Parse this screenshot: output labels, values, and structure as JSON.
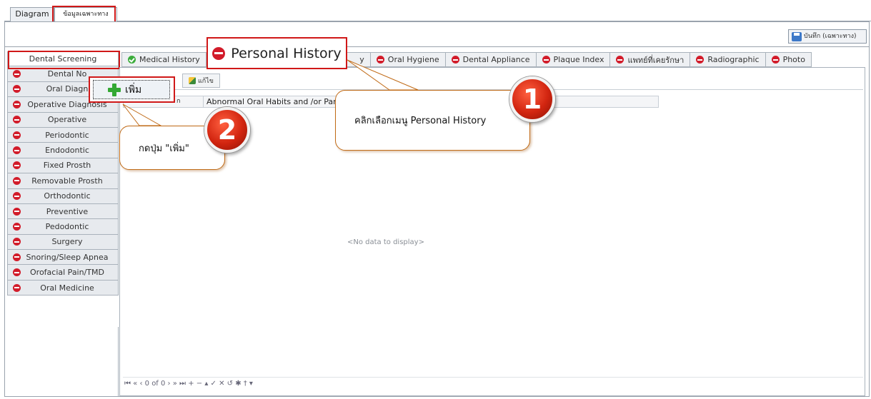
{
  "top_tabs": [
    "Diagram",
    "ข้อมูลเฉพาะทาง"
  ],
  "toolbar": {
    "save_label": "บันทึก (เฉพาะทาง)"
  },
  "left_menu": [
    {
      "label": "Dental Screening",
      "icon": "none",
      "active": true
    },
    {
      "label": "Dental No",
      "icon": "minus-circle-icon"
    },
    {
      "label": "Oral Diagn",
      "icon": "minus-circle-icon"
    },
    {
      "label": "Operative Diagnosis",
      "icon": "minus-circle-icon"
    },
    {
      "label": "Operative",
      "icon": "minus-circle-icon"
    },
    {
      "label": "Periodontic",
      "icon": "minus-circle-icon"
    },
    {
      "label": "Endodontic",
      "icon": "minus-circle-icon"
    },
    {
      "label": "Fixed Prosth",
      "icon": "minus-circle-icon"
    },
    {
      "label": "Removable Prosth",
      "icon": "minus-circle-icon"
    },
    {
      "label": "Orthodontic",
      "icon": "minus-circle-icon"
    },
    {
      "label": "Preventive",
      "icon": "minus-circle-icon"
    },
    {
      "label": "Pedodontic",
      "icon": "minus-circle-icon"
    },
    {
      "label": "Surgery",
      "icon": "minus-circle-icon"
    },
    {
      "label": "Snoring/Sleep Apnea",
      "icon": "minus-circle-icon"
    },
    {
      "label": "Orofacial Pain/TMD",
      "icon": "minus-circle-icon"
    },
    {
      "label": "Oral Medicine",
      "icon": "minus-circle-icon"
    }
  ],
  "right_tabs": [
    {
      "label": "Medical History",
      "icon": "check-circle-icon"
    },
    {
      "label": "y",
      "icon": "none"
    },
    {
      "label": "Oral Hygiene",
      "icon": "minus-circle-icon"
    },
    {
      "label": "Dental Appliance",
      "icon": "minus-circle-icon"
    },
    {
      "label": "Plaque Index",
      "icon": "minus-circle-icon"
    },
    {
      "label": "แพทย์ที่เคยรักษา",
      "icon": "minus-circle-icon"
    },
    {
      "label": "Radiographic",
      "icon": "minus-circle-icon"
    },
    {
      "label": "Photo",
      "icon": "minus-circle-icon"
    }
  ],
  "personal_history_tab": "Personal History",
  "add_button": "เพิ่ม",
  "edit_button": "แก้ไข",
  "grid": {
    "col1": "ก",
    "col2": "Abnormal Oral Habits and /or Para"
  },
  "nodata": "<No data to display>",
  "pager": "⏮ « ‹  0 of 0  › » ⏭  +  −  ▴  ✓  ✕  ↺  ✱  †  ▾",
  "callouts": {
    "one_text": "คลิกเลือกเมนู Personal History",
    "two_text": "กดปุ่ม \"เพิ่ม\"",
    "one_badge": "1",
    "two_badge": "2"
  },
  "colors": {
    "highlight": "#d01818",
    "callout_border": "#c06a16",
    "badge": "#d22510",
    "minus_icon": "#d21c2a",
    "check_icon": "#3bac3b"
  }
}
